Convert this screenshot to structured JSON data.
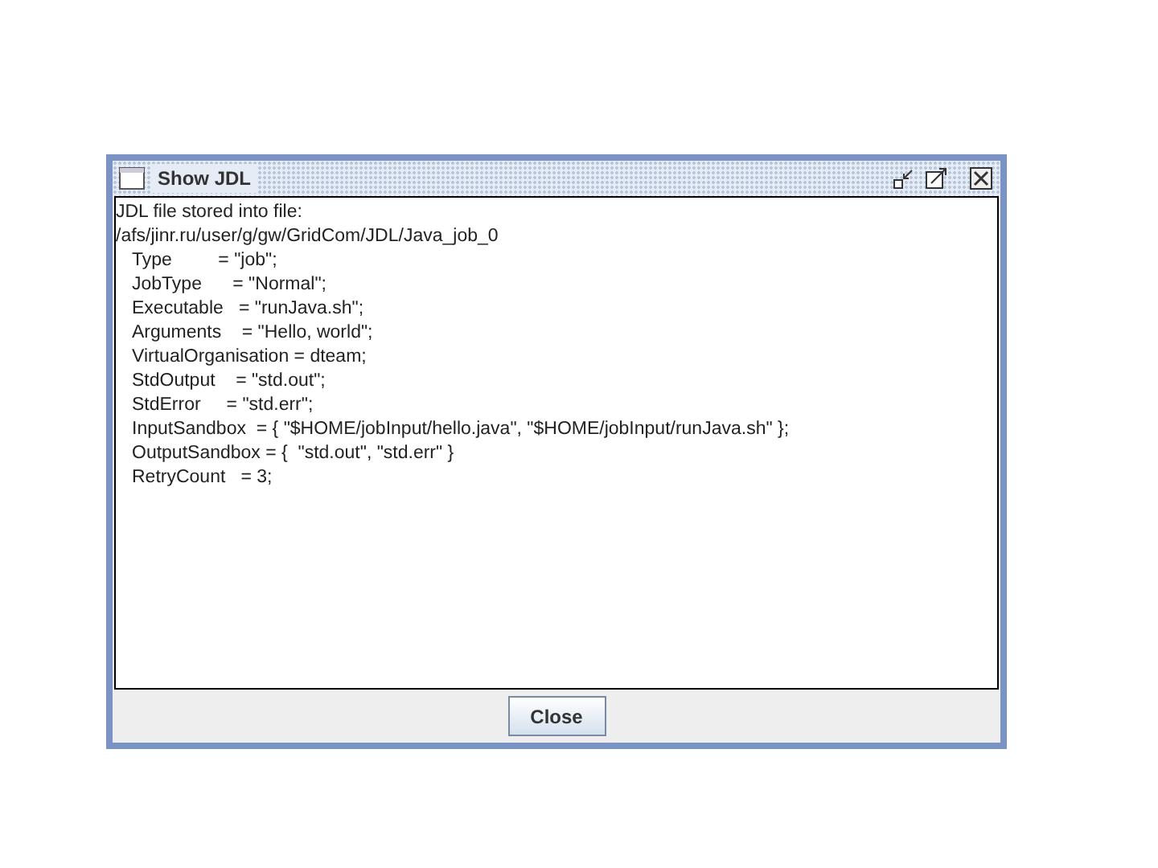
{
  "window": {
    "title": "Show JDL"
  },
  "content": {
    "header_lines": [
      "JDL file stored into file:",
      "/afs/jinr.ru/user/g/gw/GridCom/JDL/Java_job_0"
    ],
    "lines": [
      "Type         = \"job\";",
      "JobType      = \"Normal\";",
      "Executable   = \"runJava.sh\";",
      "Arguments    = \"Hello, world\";",
      "VirtualOrganisation = dteam;",
      "StdOutput    = \"std.out\";",
      "StdError     = \"std.err\";",
      "InputSandbox  = { \"$HOME/jobInput/hello.java\", \"$HOME/jobInput/runJava.sh\" };",
      "OutputSandbox = {  \"std.out\", \"std.err\" }",
      "RetryCount   = 3;"
    ]
  },
  "buttons": [
    "Close"
  ]
}
